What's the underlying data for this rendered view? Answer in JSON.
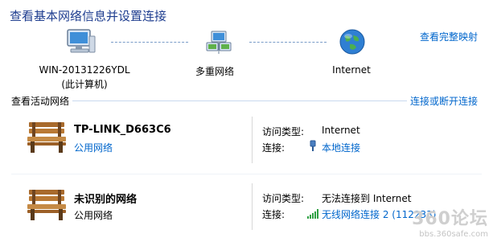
{
  "page_title": "查看基本网络信息并设置连接",
  "map_link": "查看完整映射",
  "nodes": [
    {
      "label": "WIN-20131226YDL",
      "sublabel": "(此计算机)",
      "icon": "computer-icon"
    },
    {
      "label": "多重网络",
      "icon": "multiple-networks-icon"
    },
    {
      "label": "Internet",
      "icon": "globe-icon"
    }
  ],
  "active_networks": {
    "label": "查看活动网络",
    "action": "连接或断开连接"
  },
  "networks": [
    {
      "name": "TP-LINK_D663C6",
      "type": "公用网络",
      "icon": "park-bench-icon",
      "access_label": "访问类型:",
      "access_value": "Internet",
      "connection_label": "连接:",
      "connection_value": "本地连接",
      "connection_icon": "ethernet-icon"
    },
    {
      "name": "未识别的网络",
      "type": "公用网络",
      "icon": "park-bench-icon",
      "access_label": "访问类型:",
      "access_value": "无法连接到 Internet",
      "connection_label": "连接:",
      "connection_value": "无线网络连接 2 (112233)",
      "connection_icon": "wifi-signal-icon"
    }
  ],
  "watermark": {
    "logo": "360论坛",
    "url": "bbs.360safe.com"
  },
  "colors": {
    "title": "#1e3d8f",
    "link": "#0066cc"
  }
}
